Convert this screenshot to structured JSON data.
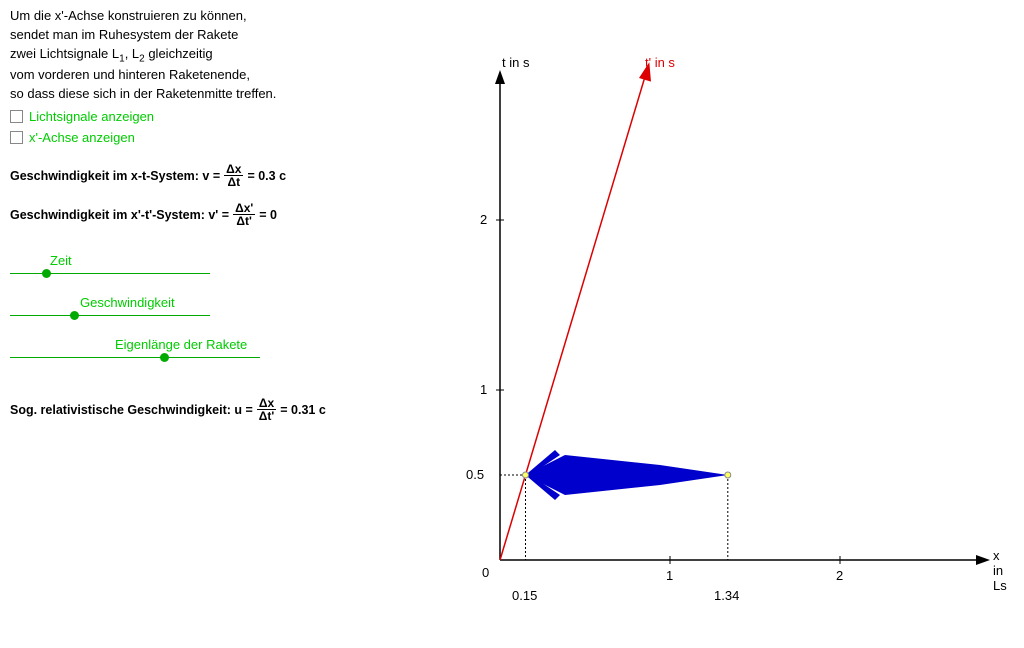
{
  "intro": {
    "line1": "Um die x'-Achse konstruieren zu können,",
    "line2": "sendet man im Ruhesystem der Rakete",
    "line3_a": "zwei Lichtsignale L",
    "line3_b": ", L",
    "line3_c": " gleichzeitig",
    "line4": "vom vorderen und hinteren Raketenende,",
    "line5": "so dass diese sich in der Raketenmitte treffen."
  },
  "checkboxes": {
    "show_light": "Lichtsignale anzeigen",
    "show_xprime": "x'-Achse anzeigen"
  },
  "formulas": {
    "v_label": "Geschwindigkeit im x-t-System: v =",
    "v_num": "Δx",
    "v_den": "Δt",
    "v_val": "= 0.3 c",
    "vp_label": "Geschwindigkeit im x'-t'-System: v' =",
    "vp_num": "Δx'",
    "vp_den": "Δt'",
    "vp_val": "= 0",
    "u_label": "Sog. relativistische Geschwindigkeit: u =",
    "u_num": "Δx",
    "u_den": "Δt'",
    "u_val": "= 0.31 c"
  },
  "sliders": {
    "time": "Zeit",
    "speed": "Geschwindigkeit",
    "length": "Eigenlänge der Rakete"
  },
  "chart_data": {
    "type": "line",
    "x_axis_label": "x in Ls",
    "y_axis_label": "t in s",
    "tprime_label": "t' in s",
    "x_ticks": [
      0,
      1,
      2
    ],
    "y_ticks": [
      1,
      2
    ],
    "origin_label": "0",
    "y_marker": 0.5,
    "x_marker_rear": 0.15,
    "x_marker_front": 1.34,
    "tprime_line": {
      "x1": 0,
      "y1": 0,
      "x2": 0.9,
      "y2": 3.0,
      "slope_v": 0.3
    },
    "rocket": {
      "y": 0.5,
      "x_rear": 0.15,
      "x_front": 1.34,
      "color": "#0000cc"
    }
  },
  "chart_labels": {
    "origin": "0",
    "half": "0.5",
    "one_y": "1",
    "two_y": "2",
    "one_x": "1",
    "two_x": "2",
    "rear": "0.15",
    "front": "1.34",
    "x_axis": "x in Ls",
    "t_axis": "t in s",
    "tprime": "t' in s"
  }
}
